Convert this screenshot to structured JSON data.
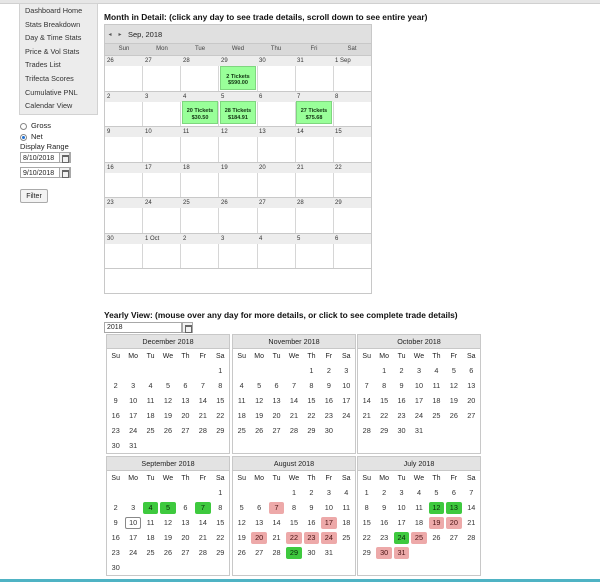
{
  "nav": {
    "items": [
      "Dashboard Home",
      "Stats Breakdown",
      "Day & Time Stats",
      "Price & Vol Stats",
      "Trades List",
      "Trifecta Scores",
      "Cumulative PNL",
      "Calendar View"
    ]
  },
  "options": {
    "gross_label": "Gross",
    "net_label": "Net",
    "selected": "Net"
  },
  "range": {
    "label": "Display Range",
    "from": "8/10/2018",
    "to": "9/10/2018"
  },
  "filter_label": "Filter",
  "month_detail": {
    "section_title": "Month in Detail: (click any day to see trade details, scroll down to see entire year)",
    "nav_prev": "◂",
    "nav_next": "▸",
    "title": "Sep, 2018",
    "dow": [
      "Sun",
      "Mon",
      "Tue",
      "Wed",
      "Thu",
      "Fri",
      "Sat"
    ],
    "weeks": [
      [
        "26",
        "27",
        "28",
        "29",
        "30",
        "31",
        "1 Sep"
      ],
      [
        "2",
        "3",
        "4",
        "5",
        "6",
        "7",
        "8"
      ],
      [
        "9",
        "10",
        "11",
        "12",
        "13",
        "14",
        "15"
      ],
      [
        "16",
        "17",
        "18",
        "19",
        "20",
        "21",
        "22"
      ],
      [
        "23",
        "24",
        "25",
        "26",
        "27",
        "28",
        "29"
      ],
      [
        "30",
        "1 Oct",
        "2",
        "3",
        "4",
        "5",
        "6"
      ]
    ],
    "events": [
      {
        "week": 0,
        "dow": 3,
        "tickets": "2 Tickets",
        "amount": "$590.00"
      },
      {
        "week": 1,
        "dow": 2,
        "tickets": "20 Tickets",
        "amount": "$30.50"
      },
      {
        "week": 1,
        "dow": 3,
        "tickets": "28 Tickets",
        "amount": "$184.91"
      },
      {
        "week": 1,
        "dow": 5,
        "tickets": "27 Tickets",
        "amount": "$75.68"
      }
    ]
  },
  "yearly": {
    "section_title": "Yearly View: (mouse over any day for more details, or click to see complete trade details)",
    "year": "2018",
    "dow": [
      "Su",
      "Mo",
      "Tu",
      "We",
      "Th",
      "Fr",
      "Sa"
    ],
    "months": [
      {
        "name": "December 2018",
        "start": 6,
        "days": 31,
        "win": [],
        "loss": []
      },
      {
        "name": "November 2018",
        "start": 4,
        "days": 30,
        "win": [],
        "loss": []
      },
      {
        "name": "October 2018",
        "start": 1,
        "days": 31,
        "win": [],
        "loss": []
      },
      {
        "name": "September 2018",
        "start": 6,
        "days": 30,
        "win": [
          4,
          5,
          7
        ],
        "loss": [],
        "today": 10
      },
      {
        "name": "August 2018",
        "start": 3,
        "days": 31,
        "win": [
          29
        ],
        "loss": [
          7,
          17,
          20,
          22,
          23,
          24
        ]
      },
      {
        "name": "July 2018",
        "start": 0,
        "days": 31,
        "win": [
          12,
          13,
          24
        ],
        "loss": [
          19,
          20,
          25,
          30,
          31
        ]
      }
    ]
  },
  "colors": {
    "win": "#3ec93e",
    "loss": "#eda9a9",
    "event": "#99ff99"
  }
}
